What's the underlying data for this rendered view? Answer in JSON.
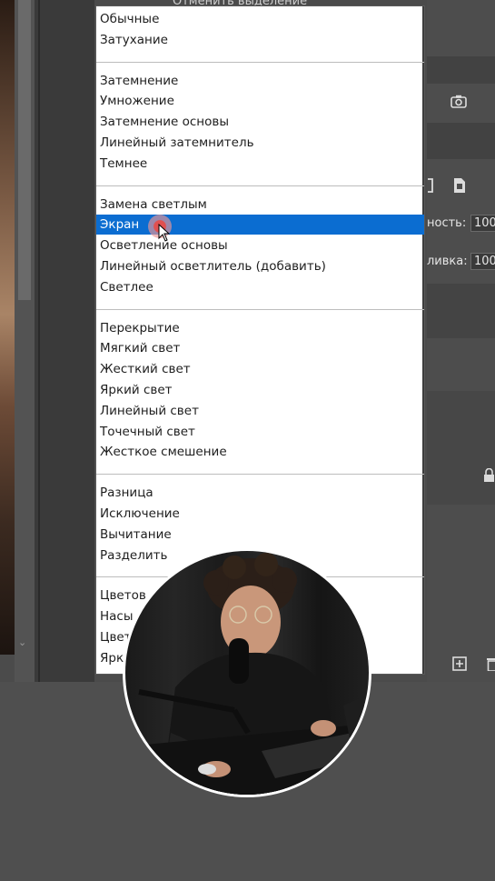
{
  "top_peek_text": "Отменить выделение",
  "blend_menu": {
    "groups": [
      [
        "Обычные",
        "Затухание"
      ],
      [
        "Затемнение",
        "Умножение",
        "Затемнение основы",
        "Линейный затемнитель",
        "Темнее"
      ],
      [
        "Замена светлым",
        "Экран",
        "Осветление основы",
        "Линейный осветлитель (добавить)",
        "Светлее"
      ],
      [
        "Перекрытие",
        "Мягкий свет",
        "Жесткий свет",
        "Яркий свет",
        "Линейный свет",
        "Точечный свет",
        "Жесткое смешение"
      ],
      [
        "Разница",
        "Исключение",
        "Вычитание",
        "Разделить"
      ],
      [
        "Цветов",
        "Насы",
        "Цвет",
        "Ярк"
      ]
    ],
    "selected": "Экран"
  },
  "layers_panel": {
    "opacity_label": "ность:",
    "opacity_value": "100",
    "fill_label": "ливка:",
    "fill_value": "100"
  },
  "icons": {
    "camera": "camera-icon",
    "copy": "copy-icon",
    "lock": "lock-icon",
    "new_layer": "new-layer-icon",
    "trash": "trash-icon",
    "chevron": "chevron-down-icon"
  },
  "colors": {
    "selection": "#0b6dd1",
    "menu_bg": "#ffffff",
    "app_bg": "#4b4b4b"
  }
}
